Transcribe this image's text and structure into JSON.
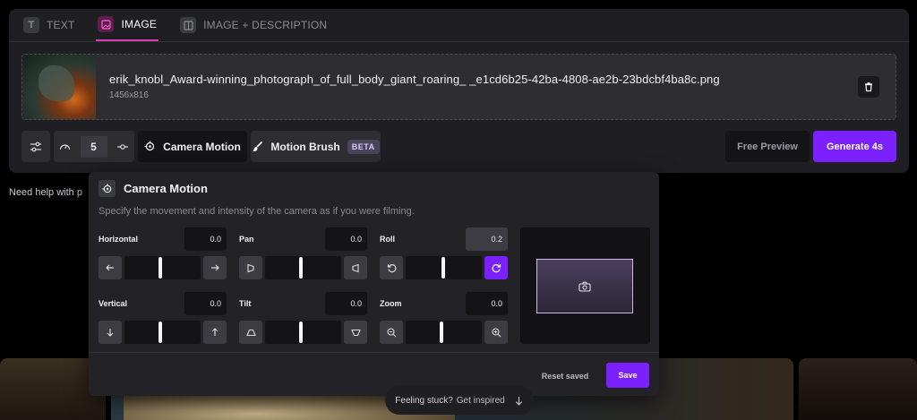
{
  "tabs": [
    {
      "label": "TEXT",
      "icon": "text-icon",
      "active": false
    },
    {
      "label": "IMAGE",
      "icon": "image-icon",
      "active": true
    },
    {
      "label": "IMAGE + DESCRIPTION",
      "icon": "image-description-icon",
      "active": false
    }
  ],
  "file": {
    "name": "erik_knobl_Award-winning_photograph_of_full_body_giant_roaring_ _e1cd6b25-42ba-4808-ae2b-23bdcbf4ba8c.png",
    "dimensions": "1456x816"
  },
  "toolbar": {
    "speed_value": "5",
    "camera_motion_label": "Camera Motion",
    "motion_brush_label": "Motion Brush",
    "beta_badge": "BETA",
    "free_preview_label": "Free Preview",
    "generate_label": "Generate 4s"
  },
  "help_text": "Need help with p",
  "camera_motion": {
    "title": "Camera Motion",
    "description": "Specify the movement and intensity of the camera as if you were filming.",
    "controls": {
      "horizontal": {
        "label": "Horizontal",
        "value": "0.0"
      },
      "pan": {
        "label": "Pan",
        "value": "0.0"
      },
      "roll": {
        "label": "Roll",
        "value": "0.2"
      },
      "vertical": {
        "label": "Vertical",
        "value": "0.0"
      },
      "tilt": {
        "label": "Tilt",
        "value": "0.0"
      },
      "zoom": {
        "label": "Zoom",
        "value": "0.0"
      }
    },
    "reset_label": "Reset saved",
    "save_label": "Save"
  },
  "footer": {
    "stuck_text": "Feeling stuck?",
    "inspired_link": "Get inspired"
  },
  "colors": {
    "accent": "#7b20ff",
    "tab_highlight": "#d63fb1",
    "panel": "#1f1f23"
  }
}
